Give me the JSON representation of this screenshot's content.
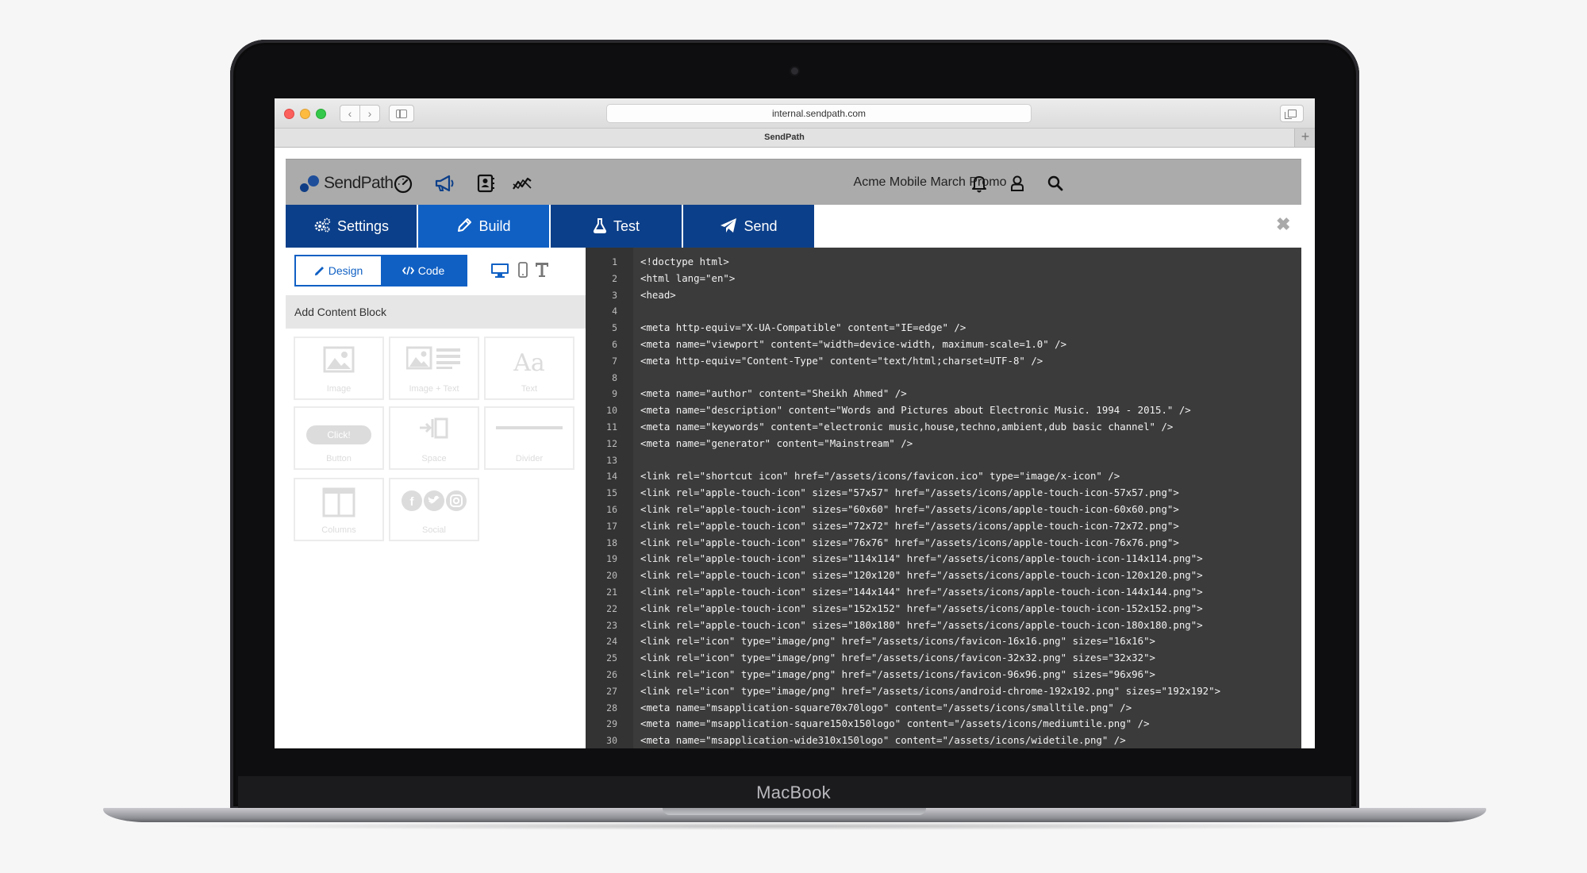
{
  "browser": {
    "url": "internal.sendpath.com",
    "tab_title": "SendPath",
    "new_tab": "+"
  },
  "app": {
    "logo_text": "SendPath",
    "campaign_title": "Acme Mobile March Promo",
    "steps": [
      {
        "label": "Settings",
        "icon": "gears-icon"
      },
      {
        "label": "Build",
        "icon": "pencil-icon"
      },
      {
        "label": "Test",
        "icon": "flask-icon"
      },
      {
        "label": "Send",
        "icon": "paper-plane-icon"
      }
    ],
    "active_step": "Build",
    "close_label": "✖",
    "mode": {
      "design": "Design",
      "code": "Code",
      "active": "Code"
    },
    "add_content_block": "Add Content Block",
    "blocks": [
      "Image",
      "Image + Text",
      "Text",
      "Button",
      "Space",
      "Divider",
      "Columns",
      "Social"
    ],
    "button_block_sample": "Click!",
    "text_block_sample": "Aa"
  },
  "colors": {
    "accent": "#1060c4",
    "step_dark": "#0c3f89",
    "header_gray": "#ababab",
    "editor_bg": "#3b3b3b"
  },
  "code": [
    {
      "n": "1",
      "t": "<!doctype html>"
    },
    {
      "n": "2",
      "t": "<html lang=\"en\">"
    },
    {
      "n": "3",
      "t": "<head>"
    },
    {
      "n": "4",
      "t": ""
    },
    {
      "n": "5",
      "t": "<meta http-equiv=\"X-UA-Compatible\" content=\"IE=edge\" />"
    },
    {
      "n": "6",
      "t": "<meta name=\"viewport\" content=\"width=device-width, maximum-scale=1.0\" />"
    },
    {
      "n": "7",
      "t": "<meta http-equiv=\"Content-Type\" content=\"text/html;charset=UTF-8\" />"
    },
    {
      "n": "8",
      "t": ""
    },
    {
      "n": "9",
      "t": "<meta name=\"author\" content=\"Sheikh Ahmed\" />"
    },
    {
      "n": "10",
      "t": "<meta name=\"description\" content=\"Words and Pictures about Electronic Music. 1994 - 2015.\" />"
    },
    {
      "n": "11",
      "t": "<meta name=\"keywords\" content=\"electronic music,house,techno,ambient,dub basic channel\" />"
    },
    {
      "n": "12",
      "t": "<meta name=\"generator\" content=\"Mainstream\" />"
    },
    {
      "n": "13",
      "t": ""
    },
    {
      "n": "14",
      "t": "<link rel=\"shortcut icon\" href=\"/assets/icons/favicon.ico\" type=\"image/x-icon\" />"
    },
    {
      "n": "15",
      "t": "<link rel=\"apple-touch-icon\" sizes=\"57x57\" href=\"/assets/icons/apple-touch-icon-57x57.png\">"
    },
    {
      "n": "16",
      "t": "<link rel=\"apple-touch-icon\" sizes=\"60x60\" href=\"/assets/icons/apple-touch-icon-60x60.png\">"
    },
    {
      "n": "17",
      "t": "<link rel=\"apple-touch-icon\" sizes=\"72x72\" href=\"/assets/icons/apple-touch-icon-72x72.png\">"
    },
    {
      "n": "18",
      "t": "<link rel=\"apple-touch-icon\" sizes=\"76x76\" href=\"/assets/icons/apple-touch-icon-76x76.png\">"
    },
    {
      "n": "19",
      "t": "<link rel=\"apple-touch-icon\" sizes=\"114x114\" href=\"/assets/icons/apple-touch-icon-114x114.png\">"
    },
    {
      "n": "20",
      "t": "<link rel=\"apple-touch-icon\" sizes=\"120x120\" href=\"/assets/icons/apple-touch-icon-120x120.png\">"
    },
    {
      "n": "21",
      "t": "<link rel=\"apple-touch-icon\" sizes=\"144x144\" href=\"/assets/icons/apple-touch-icon-144x144.png\">"
    },
    {
      "n": "22",
      "t": "<link rel=\"apple-touch-icon\" sizes=\"152x152\" href=\"/assets/icons/apple-touch-icon-152x152.png\">"
    },
    {
      "n": "23",
      "t": "<link rel=\"apple-touch-icon\" sizes=\"180x180\" href=\"/assets/icons/apple-touch-icon-180x180.png\">"
    },
    {
      "n": "24",
      "t": "<link rel=\"icon\" type=\"image/png\" href=\"/assets/icons/favicon-16x16.png\" sizes=\"16x16\">"
    },
    {
      "n": "25",
      "t": "<link rel=\"icon\" type=\"image/png\" href=\"/assets/icons/favicon-32x32.png\" sizes=\"32x32\">"
    },
    {
      "n": "26",
      "t": "<link rel=\"icon\" type=\"image/png\" href=\"/assets/icons/favicon-96x96.png\" sizes=\"96x96\">"
    },
    {
      "n": "27",
      "t": "<link rel=\"icon\" type=\"image/png\" href=\"/assets/icons/android-chrome-192x192.png\" sizes=\"192x192\">"
    },
    {
      "n": "28",
      "t": "<meta name=\"msapplication-square70x70logo\" content=\"/assets/icons/smalltile.png\" />"
    },
    {
      "n": "29",
      "t": "<meta name=\"msapplication-square150x150logo\" content=\"/assets/icons/mediumtile.png\" />"
    },
    {
      "n": "30",
      "t": "<meta name=\"msapplication-wide310x150logo\" content=\"/assets/icons/widetile.png\" />"
    }
  ],
  "device": {
    "brand_label": "MacBook"
  }
}
